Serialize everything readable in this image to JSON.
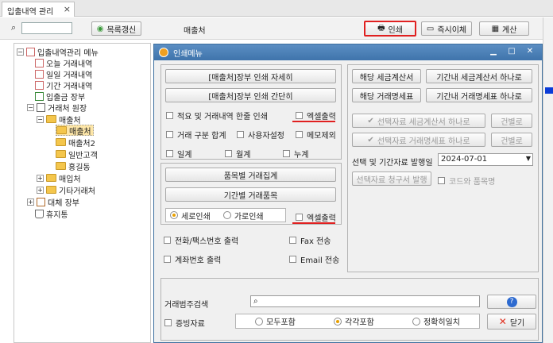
{
  "tab": {
    "title": "입출내역 관리"
  },
  "toolbar": {
    "refresh_label": "목록갱신",
    "section_label": "매출처",
    "print_label": "인쇄",
    "transfer_label": "즉시이체",
    "calc_label": "계산"
  },
  "tree": {
    "root": "입출내역관리 메뉴",
    "items": [
      "오늘 거래내역",
      "일일 거래내역",
      "기간 거래내역",
      "입출금 장부",
      "거래처 원장",
      "매출처",
      "매출처",
      "매출처2",
      "일반고객",
      "홍길동",
      "매입처",
      "기타거래처",
      "대체 장부",
      "휴지통"
    ]
  },
  "dialog": {
    "title": "인쇄메뉴",
    "detail_btn": "[매출처]장부 인쇄 자세히",
    "simple_btn": "[매출처]장부 인쇄 간단히",
    "chk_combined": "적요 및 거래내역 한줄 인쇄",
    "chk_excel1": "엑셀출력",
    "chk_trade_total": "거래 구분 합계",
    "chk_user_setting": "사용자설정",
    "chk_memo_excl": "메모제외",
    "chk_daily": "일계",
    "chk_monthly": "월계",
    "chk_cumulative": "누계",
    "item_trade_btn": "품목별 거래집계",
    "period_item_btn": "기간별 거래품목",
    "radio_vertical": "세로인쇄",
    "radio_horizontal": "가로인쇄",
    "chk_excel2": "엑셀출력",
    "chk_phone": "전화/팩스번호 출력",
    "chk_fax": "Fax 전송",
    "chk_account": "계좌번호 출력",
    "chk_email": "Email 전송",
    "tax_invoice_btn": "해당 세금계산서",
    "period_tax_btn": "기간내 세금계산서 하나로",
    "trade_stmt_btn": "해당 거래명세표",
    "period_stmt_btn": "기간내 거래명세표 하나로",
    "sel_tax_btn": "선택자료 세금계산서 하나로",
    "sel_tax_each": "건별로",
    "sel_stmt_btn": "선택자료 거래명세표 하나로",
    "sel_stmt_each": "건별로",
    "issue_date_label": "선택 및 기간자료 발행일",
    "issue_date": "2024-07-01",
    "sel_invoice_btn": "선택자료 청구서 발행",
    "chk_code_item": "코드와 품목명",
    "search_label": "거래범주검색",
    "chk_evidence": "증빙자료",
    "radio_all": "모두포함",
    "radio_each": "각각포함",
    "radio_exact": "정확히일치",
    "close_btn": "닫기"
  }
}
